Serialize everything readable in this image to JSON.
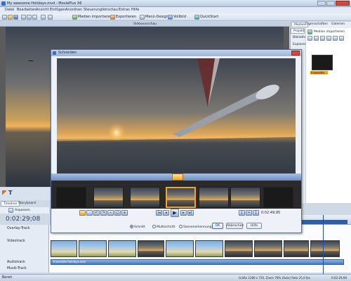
{
  "window": {
    "title": "My awesome Holidays.mvd - MoviePlus X6"
  },
  "menu": [
    "Datei",
    "Bearbeiten",
    "Ansicht",
    "Einfügen",
    "Anordnen",
    "Steuerung",
    "Vorschau",
    "Extras",
    "Hilfe"
  ],
  "toolbar": {
    "import_media": "Medien importieren",
    "export": "Exportieren",
    "menu_designer": "Menü-Designer",
    "fullscreen": "Vollbild",
    "quickstart": "QuickStart"
  },
  "preview": {
    "header": "Videovorschau"
  },
  "right_panel": {
    "tabs": [
      "Medien",
      "Eigenschaften",
      "Galerien"
    ],
    "side_tabs": [
      "Projekt",
      "Bibliothek",
      "Explorer"
    ],
    "import_label": "Medien importieren",
    "thumb_label": "Inseaside..."
  },
  "dialog": {
    "title": "Schneiden",
    "time_display": "0:02:49,95",
    "radio_options": [
      "Schnitt",
      "Multischnitt",
      "Szenenerkennung"
    ],
    "selected_radio": "Schnitt",
    "ok": "OK",
    "cancel": "Abbrechen",
    "help": "Hilfe"
  },
  "timeline": {
    "tabs": [
      "Timeline",
      "Storyboard"
    ],
    "adjust_label": "Anpassen",
    "current_time": "0:02:29;08",
    "tracks": [
      "Overlay-Track",
      "Videotrack",
      "Audiotrack",
      "Musik-Track"
    ],
    "audio_clip_label": "Inseaside holidays.wav"
  },
  "status": {
    "left": "Bereit",
    "info": "Größe 1280 x 720, Zoom 78% (Auto) Rate 25,0 fps",
    "time": "0:02:29;08"
  },
  "colors": {
    "accent": "#f5a623",
    "window_blue": "#cfd9e6",
    "title_blue": "#4a6fa5"
  }
}
